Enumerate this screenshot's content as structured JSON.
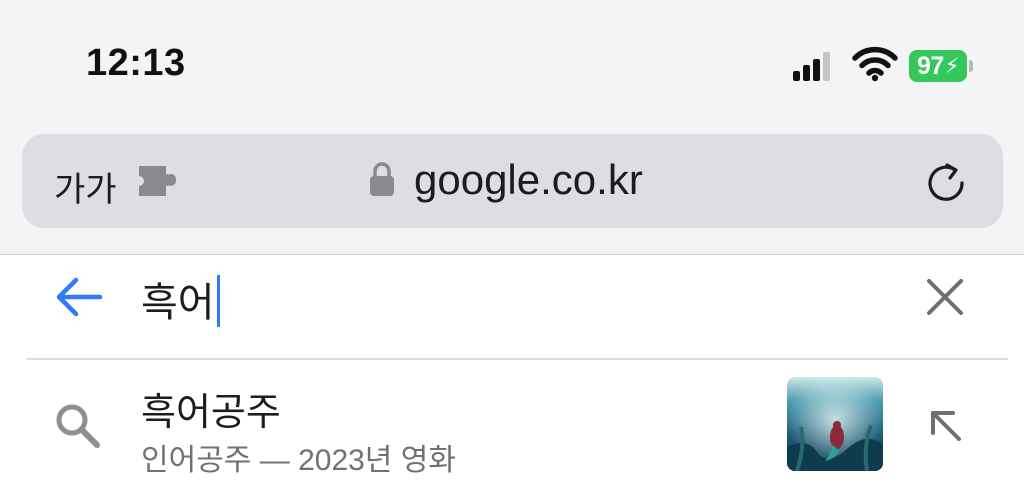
{
  "status_bar": {
    "time": "12:13",
    "signal_icon": "cellular-signal-icon",
    "wifi_icon": "wifi-icon",
    "battery_percent": "97",
    "battery_charging": true,
    "battery_color": "#34c759"
  },
  "address_bar": {
    "text_size_label": "가가",
    "extension_icon": "puzzle-piece-icon",
    "lock_icon": "lock-icon",
    "url": "google.co.kr",
    "reload_icon": "reload-icon"
  },
  "search": {
    "back_icon": "back-arrow-icon",
    "query": "흑어",
    "clear_icon": "close-icon",
    "accent_color": "#2f7cf6"
  },
  "suggestions": [
    {
      "title": "흑어공주",
      "subtitle": "인어공주 — 2023년 영화",
      "icon": "search-icon",
      "thumbnail": "movie-poster-thumbnail",
      "fill_icon": "arrow-up-left-icon"
    }
  ]
}
